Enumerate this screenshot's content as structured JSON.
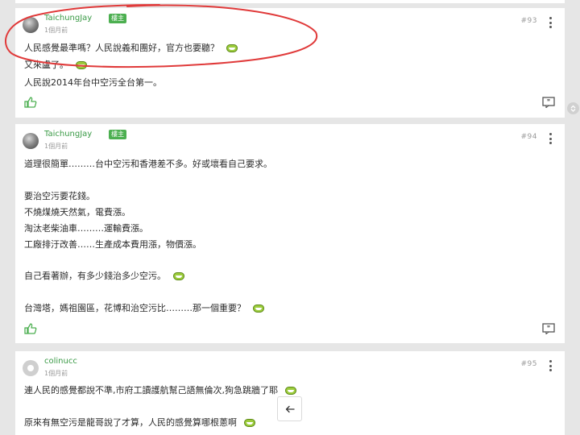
{
  "posts": [
    {
      "username": "TaichungJay",
      "badge": "樓主",
      "time": "1個月前",
      "floor": "#93",
      "lines": [
        "人民感覺最準嗎？人民說義和團好，官方也要聽？",
        "又來盧了。",
        "人民說2014年台中空污全台第一。"
      ]
    },
    {
      "username": "TaichungJay",
      "badge": "樓主",
      "time": "1個月前",
      "floor": "#94",
      "lines": [
        "道理很簡單………台中空污和香港差不多。好或壞看自己要求。",
        "要治空污要花錢。",
        "不燒煤燒天然氣，電費漲。",
        "淘汰老柴油車………運輸費漲。",
        "工廠排汙改善……生產成本費用漲，物價漲。",
        "自己看著辦，有多少錢治多少空污。",
        "台灣塔，媽祖園區，花博和治空污比………那一個重要？"
      ]
    },
    {
      "username": "colinucc",
      "time": "1個月前",
      "floor": "#95",
      "lines": [
        "連人民的感覺都說不準,市府工讀護航幫己語無倫次,狗急跳牆了耶",
        "原來有無空污是龍哥說了才算，人民的感覺算哪根蔥啊"
      ]
    }
  ],
  "colors": {
    "username": "#3a9a46",
    "badge": "#4caf50",
    "annotation": "#e03a3a"
  },
  "icons": [
    "thumbs-up-icon",
    "quote-icon",
    "more-vertical-icon",
    "back-arrow-icon",
    "emoji-icon"
  ]
}
